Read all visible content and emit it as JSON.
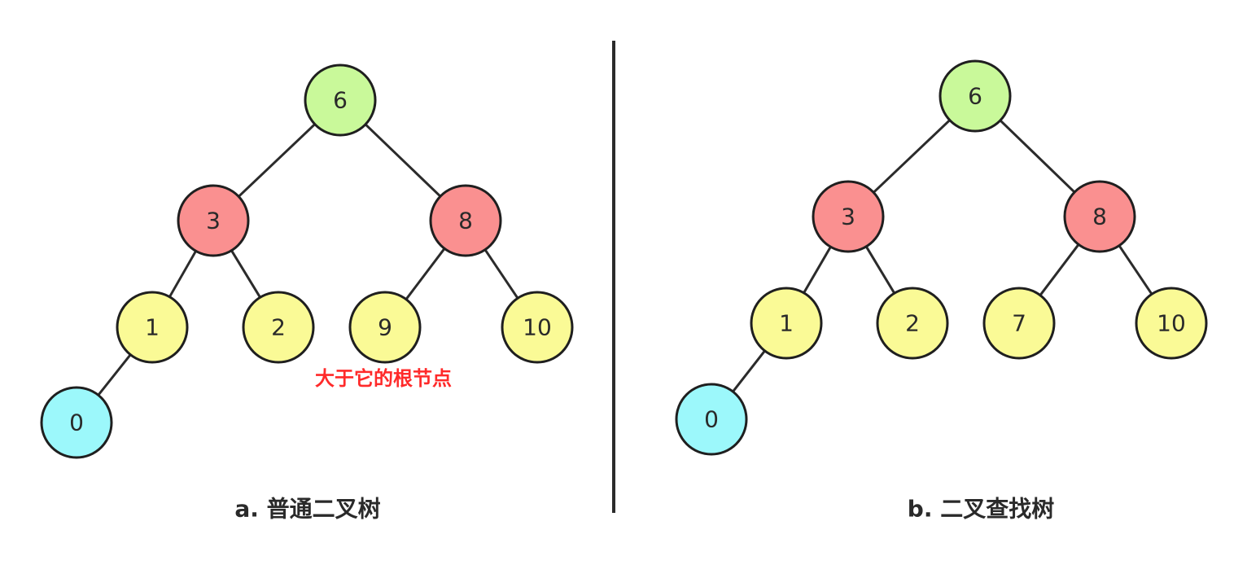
{
  "colors": {
    "root": "#c9f99a",
    "level1": "#fa9090",
    "level2": "#fafa96",
    "leaf": "#9cf8fb"
  },
  "trees": [
    {
      "caption": "a. 普通二叉树",
      "annotation": "大于它的根节点",
      "nodes": [
        {
          "value": "6",
          "color_key": "root"
        },
        {
          "value": "3",
          "color_key": "level1"
        },
        {
          "value": "8",
          "color_key": "level1"
        },
        {
          "value": "1",
          "color_key": "level2"
        },
        {
          "value": "2",
          "color_key": "level2"
        },
        {
          "value": "9",
          "color_key": "level2"
        },
        {
          "value": "10",
          "color_key": "level2"
        },
        {
          "value": "0",
          "color_key": "leaf"
        }
      ]
    },
    {
      "caption": "b. 二叉查找树",
      "nodes": [
        {
          "value": "6",
          "color_key": "root"
        },
        {
          "value": "3",
          "color_key": "level1"
        },
        {
          "value": "8",
          "color_key": "level1"
        },
        {
          "value": "1",
          "color_key": "level2"
        },
        {
          "value": "2",
          "color_key": "level2"
        },
        {
          "value": "7",
          "color_key": "level2"
        },
        {
          "value": "10",
          "color_key": "level2"
        },
        {
          "value": "0",
          "color_key": "leaf"
        }
      ]
    }
  ]
}
